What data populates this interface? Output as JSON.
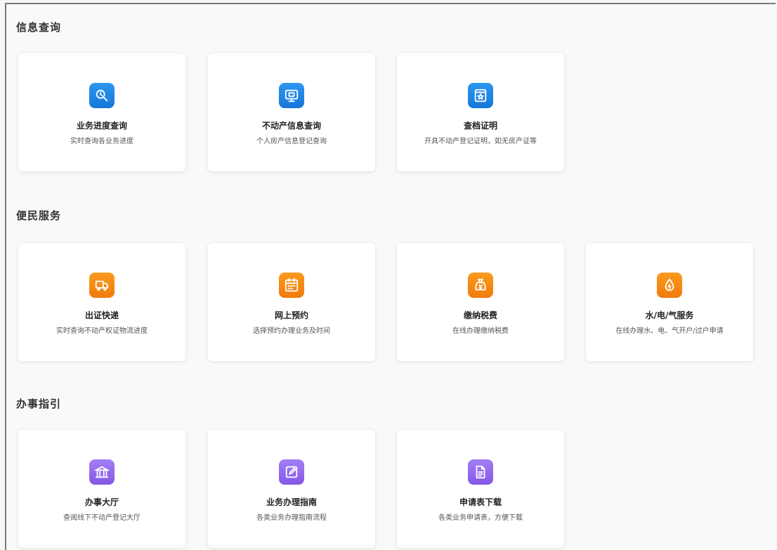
{
  "sections": [
    {
      "title": "信息查询",
      "cards": [
        {
          "title": "业务进度查询",
          "desc": "实时查询各业务进度",
          "icon": "search-progress-icon",
          "color": "#1a85e6"
        },
        {
          "title": "不动产信息查询",
          "desc": "个人房产信息登记查询",
          "icon": "monitor-icon",
          "color": "#1a85e6"
        },
        {
          "title": "查档证明",
          "desc": "开具不动产登记证明，如无房产证等",
          "icon": "certificate-icon",
          "color": "#1a85e6"
        }
      ]
    },
    {
      "title": "便民服务",
      "cards": [
        {
          "title": "出证快递",
          "desc": "实时查询不动产权证物流进度",
          "icon": "truck-icon",
          "color": "#f58a14"
        },
        {
          "title": "网上预约",
          "desc": "选择预约办理业务及时间",
          "icon": "calendar-icon",
          "color": "#f58a14"
        },
        {
          "title": "缴纳税费",
          "desc": "在线办理缴纳税费",
          "icon": "money-bag-icon",
          "color": "#f58a14"
        },
        {
          "title": "水/电/气服务",
          "desc": "在线办理水、电、气开户/过户申请",
          "icon": "water-drop-icon",
          "color": "#f58a14"
        }
      ]
    },
    {
      "title": "办事指引",
      "cards": [
        {
          "title": "办事大厅",
          "desc": "查阅线下不动产登记大厅",
          "icon": "bank-icon",
          "color": "#9168ee"
        },
        {
          "title": "业务办理指南",
          "desc": "各类业务办理指南流程",
          "icon": "edit-icon",
          "color": "#9168ee"
        },
        {
          "title": "申请表下载",
          "desc": "各类业务申请表，方便下载",
          "icon": "document-icon",
          "color": "#9168ee"
        }
      ]
    }
  ]
}
